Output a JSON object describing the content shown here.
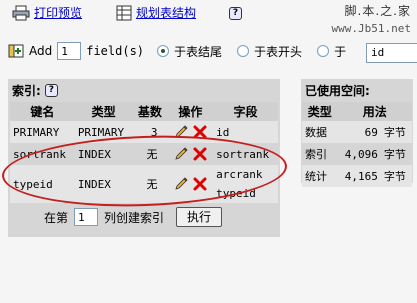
{
  "toolbar": {
    "print_preview": "打印预览",
    "plan_structure": "规划表结构",
    "plan_structure_icon": "help-icon"
  },
  "watermark": {
    "brand": "脚.本.之.家",
    "url": "www.Jb51.net"
  },
  "add_row": {
    "add_label": "Add",
    "count_value": "1",
    "fields_label": "field(s)",
    "option_end": "于表结尾",
    "option_start": "于表开头",
    "option_after": "于",
    "after_field": "id",
    "selected": "option_end"
  },
  "indexes": {
    "title": "索引:",
    "headers": [
      "键名",
      "类型",
      "基数",
      "操作",
      "字段"
    ],
    "rows": [
      {
        "keyname": "PRIMARY",
        "type": "PRIMARY",
        "cardinality": "3",
        "fields": [
          "id"
        ]
      },
      {
        "keyname": "sortrank",
        "type": "INDEX",
        "cardinality": "无",
        "fields": [
          "sortrank"
        ]
      },
      {
        "keyname": "typeid",
        "type": "INDEX",
        "cardinality": "无",
        "fields": [
          "arcrank",
          "typeid"
        ]
      }
    ],
    "create_prefix": "在第",
    "create_count": "1",
    "create_suffix": "列创建索引",
    "execute": "执行"
  },
  "space": {
    "title": "已使用空间:",
    "headers": [
      "类型",
      "用法"
    ],
    "rows": [
      {
        "type": "数据",
        "value": "69",
        "unit": "字节"
      },
      {
        "type": "索引",
        "value": "4,096",
        "unit": "字节"
      },
      {
        "type": "统计",
        "value": "4,165",
        "unit": "字节"
      }
    ]
  },
  "colors": {
    "annotation_oval": "#c41f1f",
    "link": "#0000cc",
    "delete_x": "#e00000"
  }
}
